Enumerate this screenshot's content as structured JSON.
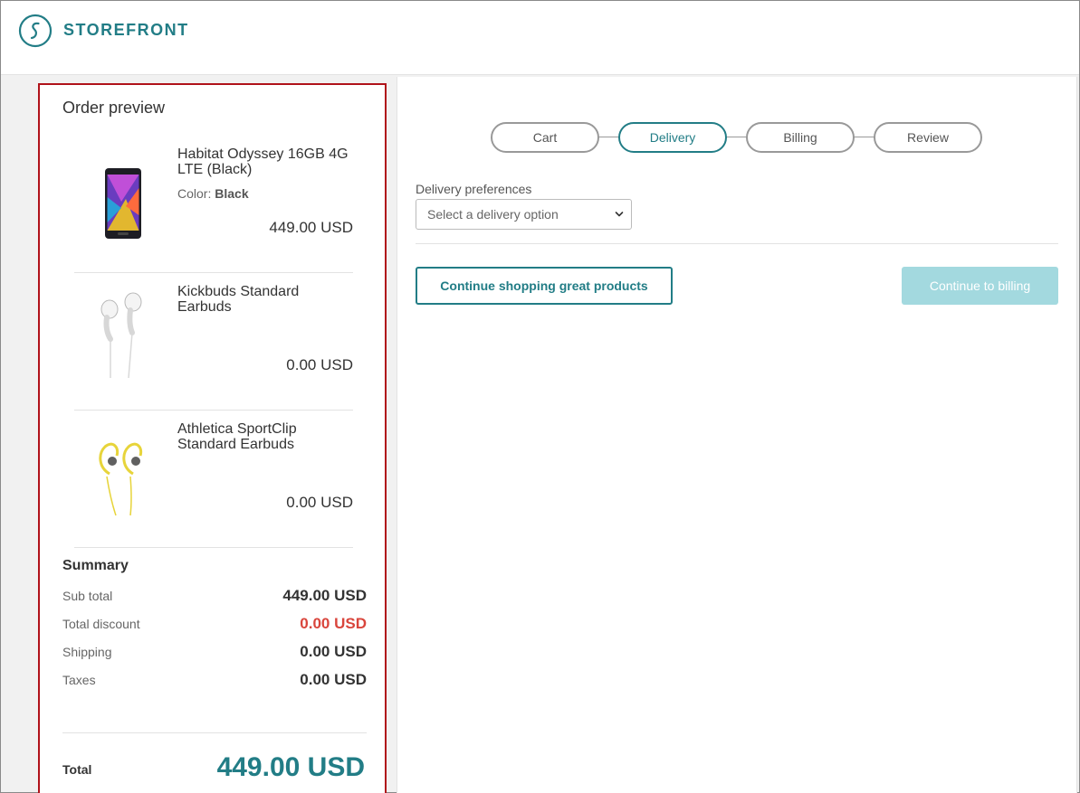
{
  "brand": {
    "name": "STOREFRONT"
  },
  "order_preview": {
    "title": "Order preview",
    "items": [
      {
        "name": "Habitat Odyssey 16GB 4G LTE (Black)",
        "color_label": "Color:",
        "color_value": "Black",
        "price": "449.00 USD",
        "image": "phone-image"
      },
      {
        "name": "Kickbuds Standard Earbuds",
        "price": "0.00 USD",
        "image": "white-earbuds-image"
      },
      {
        "name": "Athletica SportClip Standard Earbuds",
        "price": "0.00 USD",
        "image": "yellow-earbuds-image"
      }
    ],
    "summary": {
      "title": "Summary",
      "rows": [
        {
          "label": "Sub total",
          "value": "449.00 USD"
        },
        {
          "label": "Total discount",
          "value": "0.00 USD"
        },
        {
          "label": "Shipping",
          "value": "0.00 USD"
        },
        {
          "label": "Taxes",
          "value": "0.00 USD"
        }
      ],
      "total_label": "Total",
      "total_value": "449.00 USD"
    }
  },
  "checkout": {
    "steps": [
      {
        "label": "Cart",
        "active": false
      },
      {
        "label": "Delivery",
        "active": true
      },
      {
        "label": "Billing",
        "active": false
      },
      {
        "label": "Review",
        "active": false
      }
    ],
    "delivery_label": "Delivery preferences",
    "delivery_select": "Select a delivery option",
    "continue_shopping": "Continue shopping great products",
    "continue_billing": "Continue to billing"
  },
  "colors": {
    "accent": "#227d86",
    "discount": "#d9453c",
    "disabled_button": "#a3d9df",
    "highlight_border": "#b0121a"
  }
}
